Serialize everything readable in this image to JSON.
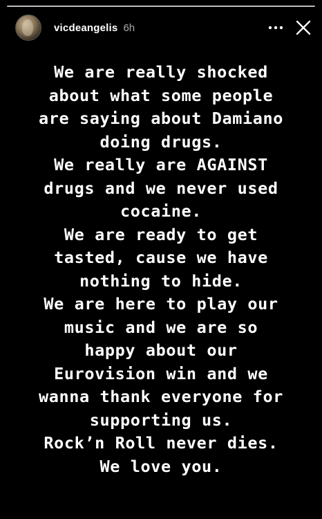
{
  "header": {
    "username": "vicdeangelis",
    "time": "6h",
    "more_icon": "more-horizontal-icon",
    "close_icon": "close-icon"
  },
  "progress": {
    "fraction": 1
  },
  "story": {
    "text": "We are really shocked\nabout what some people\nare saying about Damiano\ndoing drugs.\nWe really are AGAINST\ndrugs and we never used\ncocaine.\nWe are ready to get\ntasted, cause we have\nnothing to hide.\nWe are here to play our\nmusic and we are so\nhappy about our\nEurovision win and we\nwanna thank everyone for\nsupporting us.\nRock’n Roll never dies.\nWe love you."
  },
  "colors": {
    "background": "#000000",
    "text": "#ffffff",
    "muted": "#a6a6a6"
  }
}
